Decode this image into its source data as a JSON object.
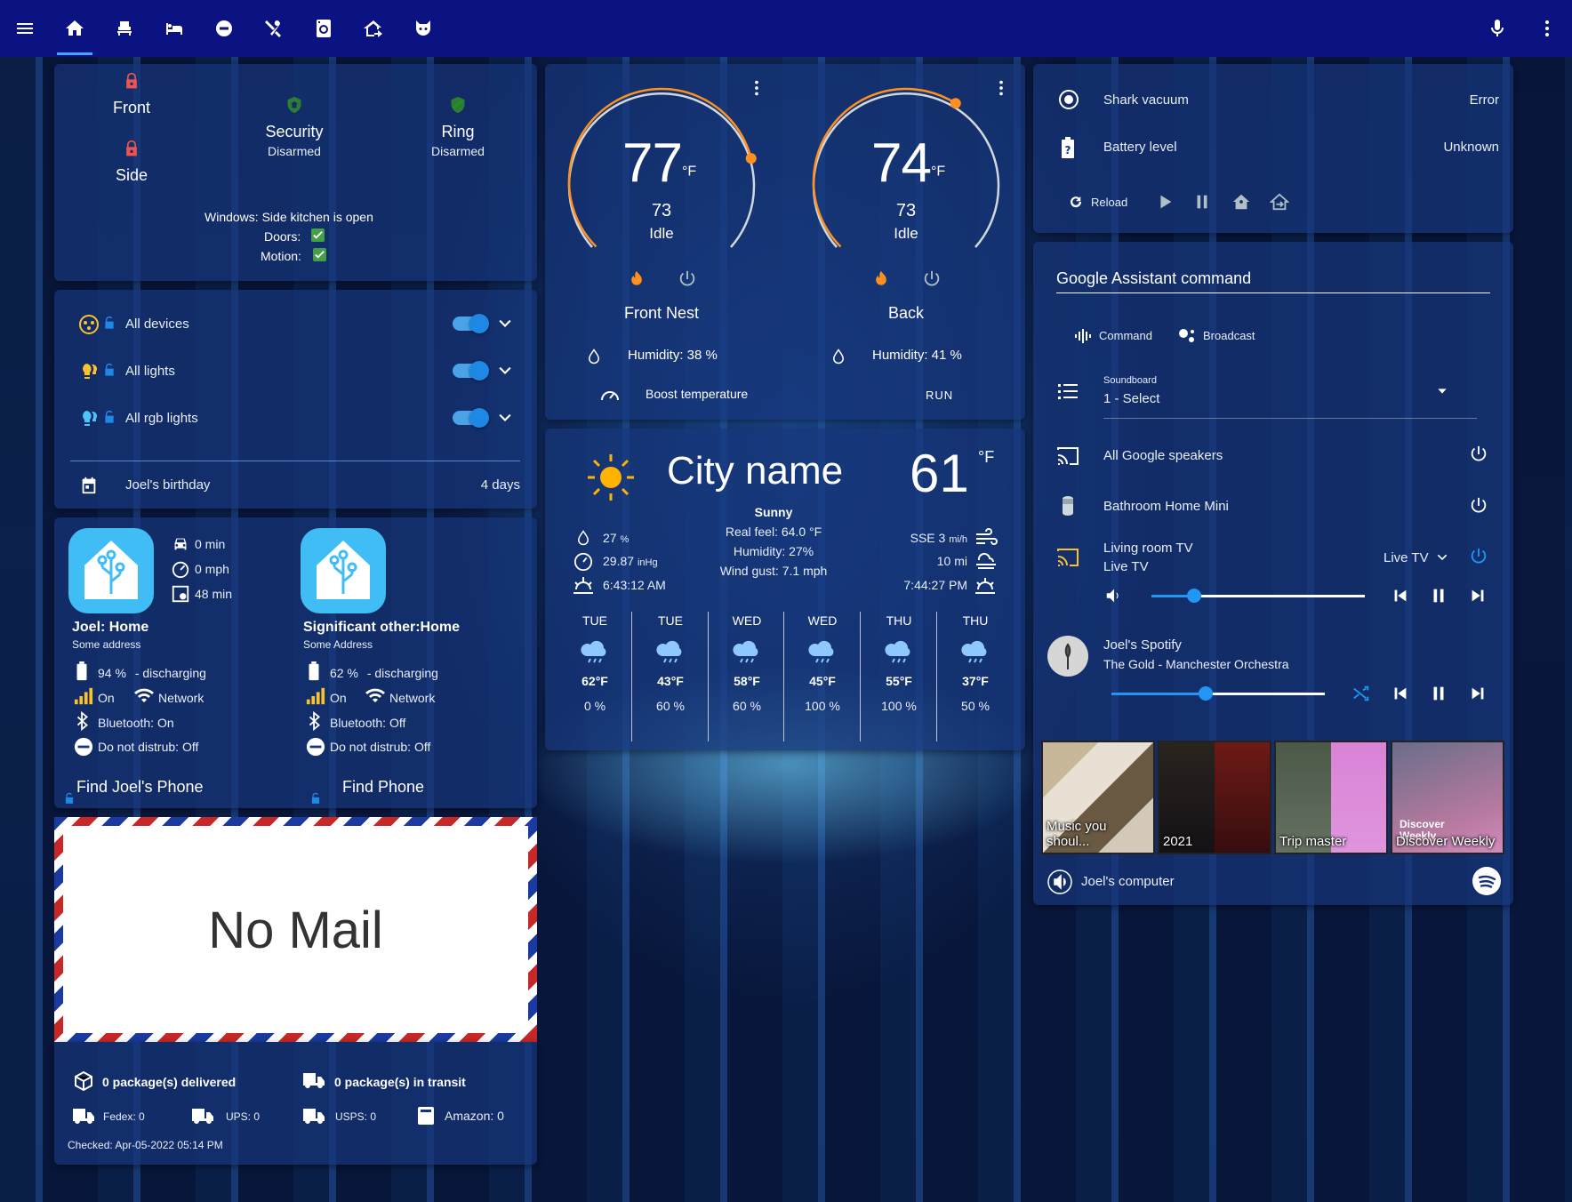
{
  "topbar": {
    "icons": [
      "menu-icon",
      "home-icon",
      "sofa-icon",
      "bed-icon",
      "record-icon",
      "kitchen-icon",
      "washer-icon",
      "home-export-icon",
      "cat-icon"
    ],
    "right_icons": [
      "microphone-icon",
      "more-vertical-icon"
    ]
  },
  "security": {
    "locks": [
      {
        "label": "Front"
      },
      {
        "label": "Side"
      }
    ],
    "panels": [
      {
        "label": "Security",
        "state": "Disarmed"
      },
      {
        "label": "Ring",
        "state": "Disarmed"
      }
    ],
    "windows_label": "Windows:",
    "windows_value": "Side kitchen is open",
    "doors_label": "Doors:",
    "motion_label": "Motion:"
  },
  "toggles": {
    "items": [
      {
        "label": "All devices"
      },
      {
        "label": "All lights"
      },
      {
        "label": "All rgb lights"
      }
    ],
    "birthday_label": "Joel's birthday",
    "birthday_value": "4 days"
  },
  "people": [
    {
      "name": "Joel: Home",
      "address": "Some address",
      "travel": [
        "0 min",
        "0 mph",
        "48 min"
      ],
      "battery": "94 %",
      "battery_state": "- discharging",
      "signal": "On",
      "network": "Network",
      "bluetooth": "Bluetooth: On",
      "dnd": "Do not distrub: Off",
      "find": "Find Joel's Phone"
    },
    {
      "name": "Significant other:Home",
      "address": "Some Address",
      "battery": "62 %",
      "battery_state": "- discharging",
      "signal": "On",
      "network": "Network",
      "bluetooth": "Bluetooth: Off",
      "dnd": "Do not distrub: Off",
      "find": "Find Phone"
    }
  ],
  "mail": {
    "title": "No Mail",
    "delivered": "0 package(s) delivered",
    "in_transit": "0 package(s) in transit",
    "fedex": "Fedex: 0",
    "ups": "UPS: 0",
    "usps": "USPS: 0",
    "amazon": "Amazon: 0",
    "checked": "Checked: Apr-05-2022 05:14 PM"
  },
  "thermostats": [
    {
      "temp": "77",
      "unit": "°F",
      "target": "73",
      "state": "Idle",
      "name": "Front Nest",
      "humidity": "Humidity: 38 %",
      "level": 0.78
    },
    {
      "temp": "74",
      "unit": "°F",
      "target": "73",
      "state": "Idle",
      "name": "Back",
      "humidity": "Humidity: 41 %",
      "level": 0.62
    }
  ],
  "boost": {
    "label": "Boost temperature",
    "action": "RUN"
  },
  "weather": {
    "city": "City name",
    "temp": "61",
    "unit": "°F",
    "condition": "Sunny",
    "real_feel": "Real feel: 64.0 °F",
    "humidity": "Humidity: 27%",
    "wind_gust": "Wind gust: 7.1 mph",
    "precip": "27",
    "precip_unit": "%",
    "pressure": "29.87",
    "pressure_unit": "inHg",
    "sunrise": "6:43:12 AM",
    "wind": "SSE 3",
    "wind_unit": "mi/h",
    "visibility": "10 mi",
    "sunset": "7:44:27 PM",
    "forecast": [
      {
        "day": "TUE",
        "temp": "62°F",
        "precip": "0 %"
      },
      {
        "day": "TUE",
        "temp": "43°F",
        "precip": "60 %"
      },
      {
        "day": "WED",
        "temp": "58°F",
        "precip": "60 %"
      },
      {
        "day": "WED",
        "temp": "45°F",
        "precip": "100 %"
      },
      {
        "day": "THU",
        "temp": "55°F",
        "precip": "100 %"
      },
      {
        "day": "THU",
        "temp": "37°F",
        "precip": "50 %"
      }
    ]
  },
  "vacuum": {
    "name": "Shark vacuum",
    "state": "Error",
    "battery_label": "Battery level",
    "battery_value": "Unknown",
    "reload": "Reload"
  },
  "assistant": {
    "title": "Google Assistant command",
    "command_tab": "Command",
    "broadcast_tab": "Broadcast",
    "soundboard_label": "Soundboard",
    "soundboard_value": "1 - Select"
  },
  "media": {
    "speakers": "All Google speakers",
    "bathroom": "Bathroom Home Mini",
    "tv_name": "Living room TV",
    "tv_state": "Live TV",
    "tv_source": "Live TV",
    "tv_volume": 0.2,
    "spotify_name": "Joel's Spotify",
    "spotify_track": "The Gold - Manchester Orchestra",
    "spotify_volume": 0.44,
    "playlists": [
      "Music you shoul...",
      "2021",
      "Trip master",
      "Discover Weekly"
    ],
    "discover_art_text": "Discover Weekly",
    "device": "Joel's computer"
  },
  "colors": {
    "topbar": "#0b1382",
    "accent": "#2196f3",
    "thermo_arc": "#ff8f1f",
    "lock": "#ef5350",
    "shield": "#2e7d32"
  }
}
